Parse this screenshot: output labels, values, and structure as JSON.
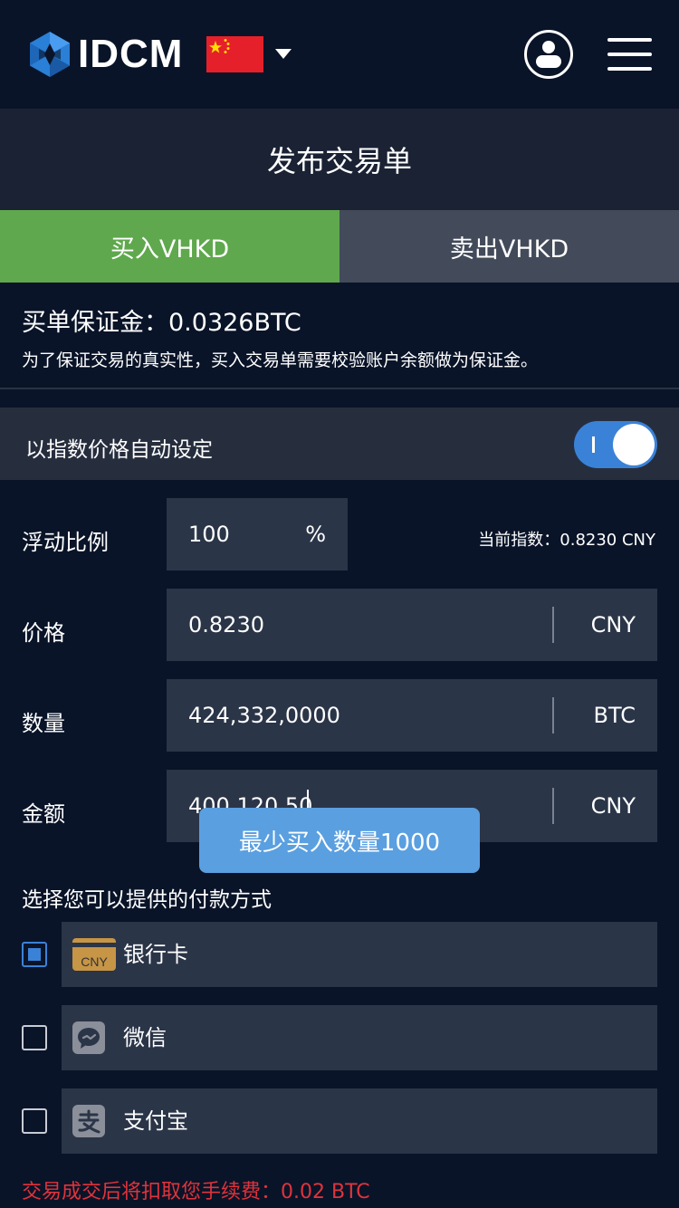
{
  "header": {
    "logo_text": "IDCM",
    "flag_icon": "china-flag-icon",
    "colors": {
      "background": "#0a1428",
      "brand_blue": "#2a7fd6"
    }
  },
  "title": "发布交易单",
  "tabs": [
    {
      "label": "买入VHKD",
      "active": true,
      "color": "#5fa84d"
    },
    {
      "label": "卖出VHKD",
      "active": false,
      "color": "#434b5a"
    }
  ],
  "deposit": {
    "title": "买单保证金：0.0326BTC",
    "description": "为了保证交易的真实性，买入交易单需要校验账户余额做为保证金。"
  },
  "auto_setting": {
    "label": "以指数价格自动设定",
    "enabled": true
  },
  "form": {
    "float_ratio": {
      "label": "浮动比例",
      "value": "100",
      "unit": "%"
    },
    "current_index": "当前指数：0.8230 CNY",
    "price": {
      "label": "价格",
      "value": "0.8230",
      "unit": "CNY"
    },
    "quantity": {
      "label": "数量",
      "value": "424,332,0000",
      "unit": "BTC"
    },
    "amount": {
      "label": "金额",
      "value": "400,120.50",
      "unit": "CNY"
    }
  },
  "tooltip": "最少买入数量1000",
  "payment": {
    "title": "选择您可以提供的付款方式",
    "methods": [
      {
        "label": "银行卡",
        "icon": "bank-card-icon",
        "icon_text": "CNY",
        "checked": true
      },
      {
        "label": "微信",
        "icon": "wechat-icon",
        "checked": false
      },
      {
        "label": "支付宝",
        "icon": "alipay-icon",
        "checked": false
      }
    ]
  },
  "fee_note": "交易成交后将扣取您手续费：0.02 BTC"
}
